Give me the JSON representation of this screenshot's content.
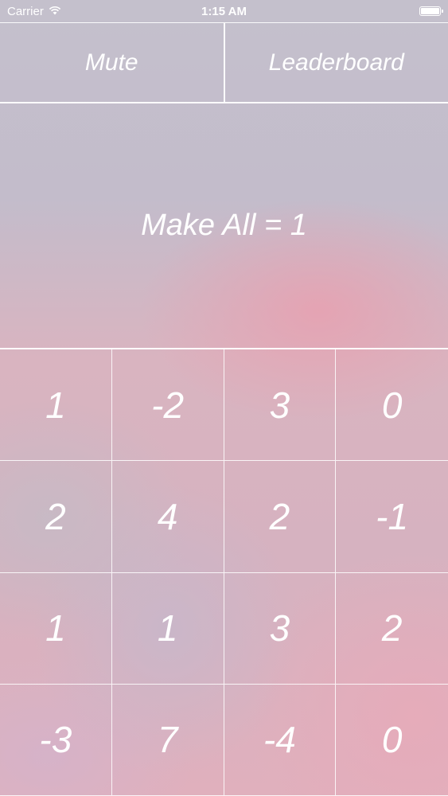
{
  "status_bar": {
    "carrier": "Carrier",
    "time": "1:15 AM",
    "battery_level": 1.0
  },
  "top_buttons": {
    "mute_label": "Mute",
    "leaderboard_label": "Leaderboard"
  },
  "goal": {
    "text": "Make All = 1"
  },
  "grid": {
    "cells": [
      [
        "1",
        "-2",
        "3",
        "0"
      ],
      [
        "2",
        "4",
        "2",
        "-1"
      ],
      [
        "1",
        "1",
        "3",
        "2"
      ],
      [
        "-3",
        "7",
        "-4",
        "0"
      ]
    ]
  },
  "colors": {
    "text": "#ffffff",
    "divider": "#ffffff"
  }
}
